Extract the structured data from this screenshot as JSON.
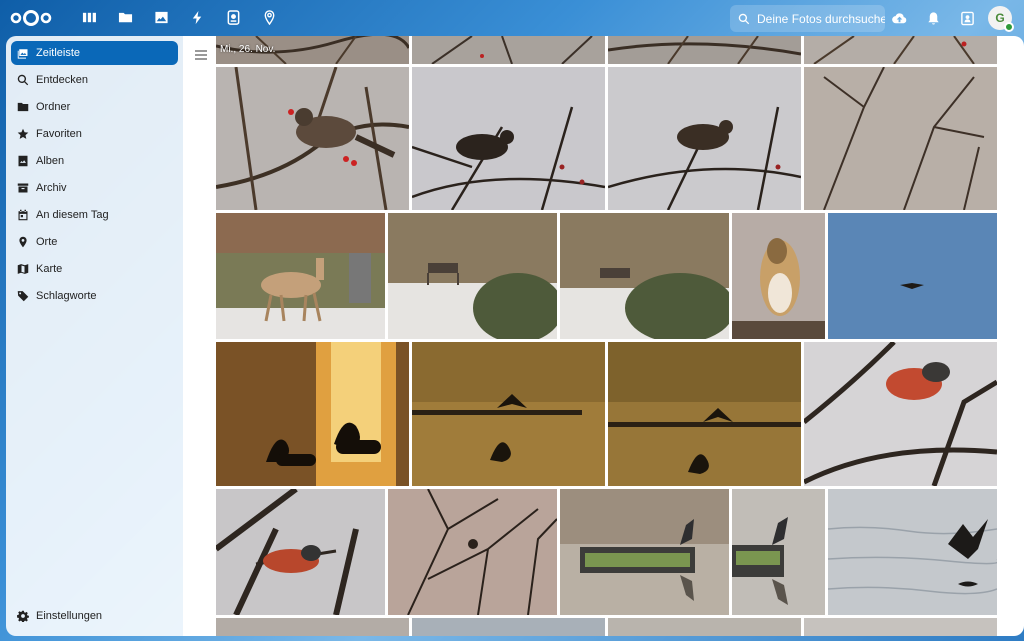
{
  "header": {
    "search_placeholder": "Deine Fotos durchsuche…",
    "avatar_initial": "G",
    "apps": [
      {
        "icon": "dashboard-icon"
      },
      {
        "icon": "files-icon"
      },
      {
        "icon": "photos-icon"
      },
      {
        "icon": "activity-icon"
      },
      {
        "icon": "memories-icon"
      },
      {
        "icon": "maps-icon"
      }
    ]
  },
  "sidebar": {
    "items": [
      {
        "label": "Zeitleiste",
        "icon": "timeline-icon"
      },
      {
        "label": "Entdecken",
        "icon": "search-icon"
      },
      {
        "label": "Ordner",
        "icon": "folder-icon"
      },
      {
        "label": "Favoriten",
        "icon": "star-icon"
      },
      {
        "label": "Alben",
        "icon": "album-icon"
      },
      {
        "label": "Archiv",
        "icon": "archive-icon"
      },
      {
        "label": "An diesem Tag",
        "icon": "calendar-icon"
      },
      {
        "label": "Orte",
        "icon": "location-icon"
      },
      {
        "label": "Karte",
        "icon": "map-icon"
      },
      {
        "label": "Schlagworte",
        "icon": "tag-icon"
      }
    ],
    "settings_label": "Einstellungen"
  },
  "main": {
    "date_label": "Mi., 26. Nov.",
    "photos": [
      {
        "subject": "bird-branches"
      },
      {
        "subject": "bird-branches"
      },
      {
        "subject": "bird-branches"
      },
      {
        "subject": "bird-branches"
      },
      {
        "subject": "thrush-berries"
      },
      {
        "subject": "bird-silhouette"
      },
      {
        "subject": "bird-silhouette"
      },
      {
        "subject": "bare-branches"
      },
      {
        "subject": "deer-snow"
      },
      {
        "subject": "snowy-park-bench"
      },
      {
        "subject": "snowy-park-bench"
      },
      {
        "subject": "collie-dog"
      },
      {
        "subject": "bird-in-sky"
      },
      {
        "subject": "swans-sunset"
      },
      {
        "subject": "cormorant-lake"
      },
      {
        "subject": "cormorant-lake"
      },
      {
        "subject": "bullfinch-branch"
      },
      {
        "subject": "bullfinch-branch"
      },
      {
        "subject": "tree-silhouette"
      },
      {
        "subject": "heron-platform"
      },
      {
        "subject": "heron-platform"
      },
      {
        "subject": "heron-flying-water"
      },
      {
        "subject": "partial-next-row"
      },
      {
        "subject": "partial-next-row"
      },
      {
        "subject": "partial-next-row"
      },
      {
        "subject": "partial-next-row"
      }
    ]
  }
}
